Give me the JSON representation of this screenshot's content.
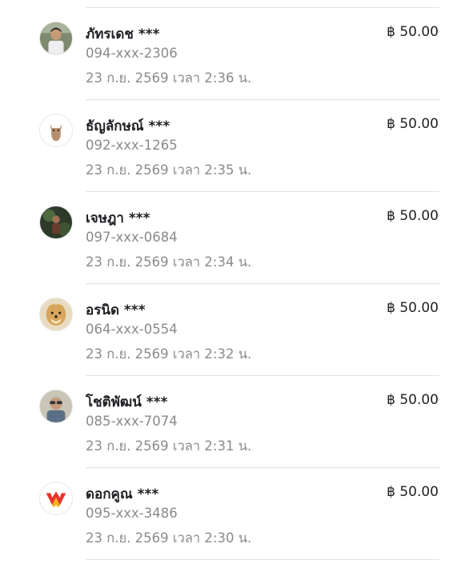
{
  "transactions": [
    {
      "name": "ภัทรเดช ***",
      "phone": "094-xxx-2306",
      "time": "23 ก.ย. 2569 เวลา 2:36 น.",
      "amount": "฿ 50.00",
      "avatar": "person-avatar-icon"
    },
    {
      "name": "ธัญลักษณ์ ***",
      "phone": "092-xxx-1265",
      "time": "23 ก.ย. 2569 เวลา 2:35 น.",
      "amount": "฿ 50.00",
      "avatar": "cat-avatar-icon"
    },
    {
      "name": "เจษฎา ***",
      "phone": "097-xxx-0684",
      "time": "23 ก.ย. 2569 เวลา 2:34 น.",
      "amount": "฿ 50.00",
      "avatar": "dark-photo-avatar-icon"
    },
    {
      "name": "อรนิด ***",
      "phone": "064-xxx-0554",
      "time": "23 ก.ย. 2569 เวลา 2:32 น.",
      "amount": "฿ 50.00",
      "avatar": "doge-avatar-icon"
    },
    {
      "name": "โชติพัฒน์ ***",
      "phone": "085-xxx-7074",
      "time": "23 ก.ย. 2569 เวลา 2:31 น.",
      "amount": "฿ 50.00",
      "avatar": "person-glasses-avatar-icon"
    },
    {
      "name": "ดอกคูณ ***",
      "phone": "095-xxx-3486",
      "time": "23 ก.ย. 2569 เวลา 2:30 น.",
      "amount": "฿ 50.00",
      "avatar": "w-logo-avatar-icon"
    }
  ]
}
